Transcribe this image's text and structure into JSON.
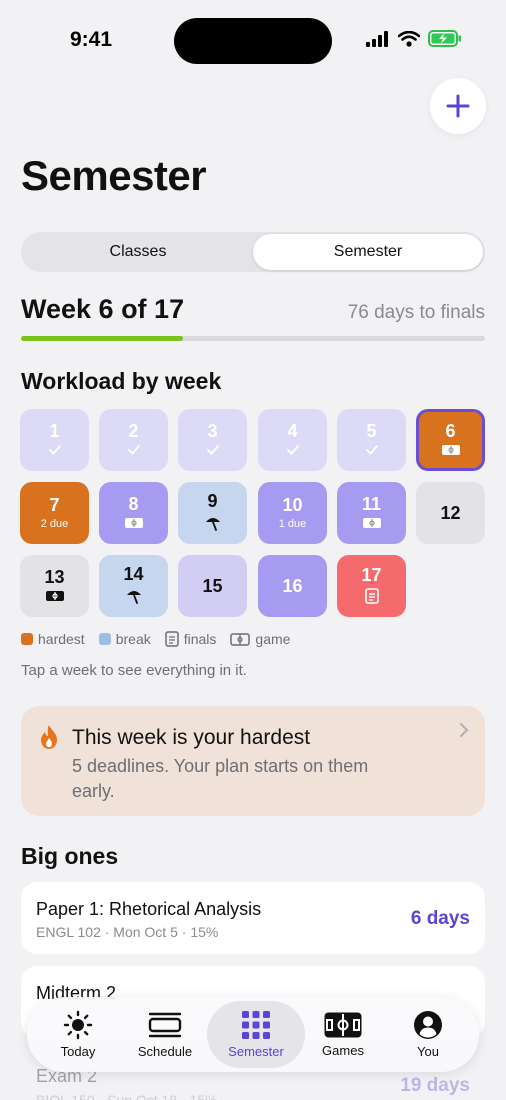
{
  "status": {
    "time": "9:41"
  },
  "header": {
    "title": "Semester"
  },
  "segments": [
    "Classes",
    "Semester"
  ],
  "segment_selected": "Semester",
  "week": {
    "title": "Week 6 of 17",
    "days_to_finals": "76 days to finals",
    "progress": 0.35
  },
  "workload": {
    "title": "Workload by week",
    "weeks": [
      {
        "num": "1",
        "sub": "✓",
        "kind": "past"
      },
      {
        "num": "2",
        "sub": "✓",
        "kind": "past"
      },
      {
        "num": "3",
        "sub": "✓",
        "kind": "past"
      },
      {
        "num": "4",
        "sub": "✓",
        "kind": "past"
      },
      {
        "num": "5",
        "sub": "✓",
        "kind": "past"
      },
      {
        "num": "6",
        "sub": "game",
        "kind": "hardest-current"
      },
      {
        "num": "7",
        "sub": "2 due",
        "kind": "hardest"
      },
      {
        "num": "8",
        "sub": "game",
        "kind": "heavy"
      },
      {
        "num": "9",
        "sub": "break",
        "kind": "break"
      },
      {
        "num": "10",
        "sub": "1 due",
        "kind": "heavy"
      },
      {
        "num": "11",
        "sub": "game",
        "kind": "heavy"
      },
      {
        "num": "12",
        "sub": "",
        "kind": "light"
      },
      {
        "num": "13",
        "sub": "game",
        "kind": "light"
      },
      {
        "num": "14",
        "sub": "break",
        "kind": "break"
      },
      {
        "num": "15",
        "sub": "",
        "kind": "medium"
      },
      {
        "num": "16",
        "sub": "",
        "kind": "heavy"
      },
      {
        "num": "17",
        "sub": "finals",
        "kind": "finals"
      }
    ]
  },
  "legend": {
    "hardest": "hardest",
    "break": "break",
    "finals": "finals",
    "game": "game"
  },
  "hint": "Tap a week to see everything in it.",
  "alert": {
    "title": "This week is your hardest",
    "body": "5 deadlines. Your plan starts on them early."
  },
  "big_ones": {
    "title": "Big ones",
    "items": [
      {
        "title": "Paper 1: Rhetorical Analysis",
        "meta": "ENGL 102 · Mon Oct 5 · 15%",
        "days": "6 days"
      },
      {
        "title": "Midterm 2",
        "meta": "",
        "days": ""
      },
      {
        "title": "Exam 2",
        "meta": "BIOL 150 · Sun Oct 18 · 15%",
        "days": "19 days"
      }
    ]
  },
  "tabs": [
    {
      "label": "Today",
      "icon": "sun-icon"
    },
    {
      "label": "Schedule",
      "icon": "schedule-icon"
    },
    {
      "label": "Semester",
      "icon": "grid-icon"
    },
    {
      "label": "Games",
      "icon": "field-icon"
    },
    {
      "label": "You",
      "icon": "person-icon"
    }
  ],
  "colors": {
    "accent": "#5b46d4",
    "hardest": "#d9721f",
    "break": "#9fbbe6",
    "finals": "#f56a6d",
    "progress": "#7cc21a"
  }
}
